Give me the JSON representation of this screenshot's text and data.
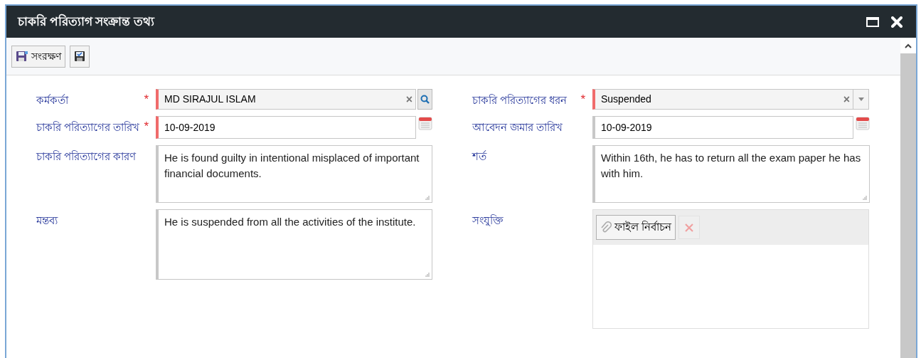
{
  "window": {
    "title": "চাকরি পরিত্যাগ সংক্রান্ত তথ্য"
  },
  "toolbar": [
    {
      "kind": "save",
      "label": "সংরক্ষণ"
    },
    {
      "kind": "save-close"
    }
  ],
  "left_fields": [
    {
      "label": "কর্মকর্তা",
      "kind": "lookup",
      "required": true,
      "asterisk": "*",
      "value": "MD SIRAJUL ISLAM",
      "clear": "×"
    },
    {
      "label": "চাকরি পরিত্যাগের তারিখ",
      "kind": "date",
      "required": true,
      "asterisk": "*",
      "value": "10-09-2019"
    },
    {
      "label": "চাকরি পরিত্যাগের কারণ",
      "kind": "textarea",
      "required": false,
      "value": "He is found guilty in intentional misplaced of important financial documents."
    },
    {
      "label": "মন্তব্য",
      "kind": "textarea",
      "required": false,
      "value": "He is suspended from all the activities of the institute."
    }
  ],
  "right_fields": [
    {
      "label": "চাকরি পরিত্যাগের ধরন",
      "kind": "select",
      "required": true,
      "asterisk": "*",
      "value": "Suspended",
      "clear": "×"
    },
    {
      "label": "আবেদন জমার তারিখ",
      "kind": "date",
      "required": false,
      "value": "10-09-2019"
    },
    {
      "label": "শর্ত",
      "kind": "textarea",
      "required": false,
      "value": "Within 16th, he has to return all the exam paper he has with him."
    },
    {
      "label": "সংযুক্তি",
      "kind": "attachment",
      "required": false,
      "button": "ফাইল নির্বাচন"
    }
  ]
}
